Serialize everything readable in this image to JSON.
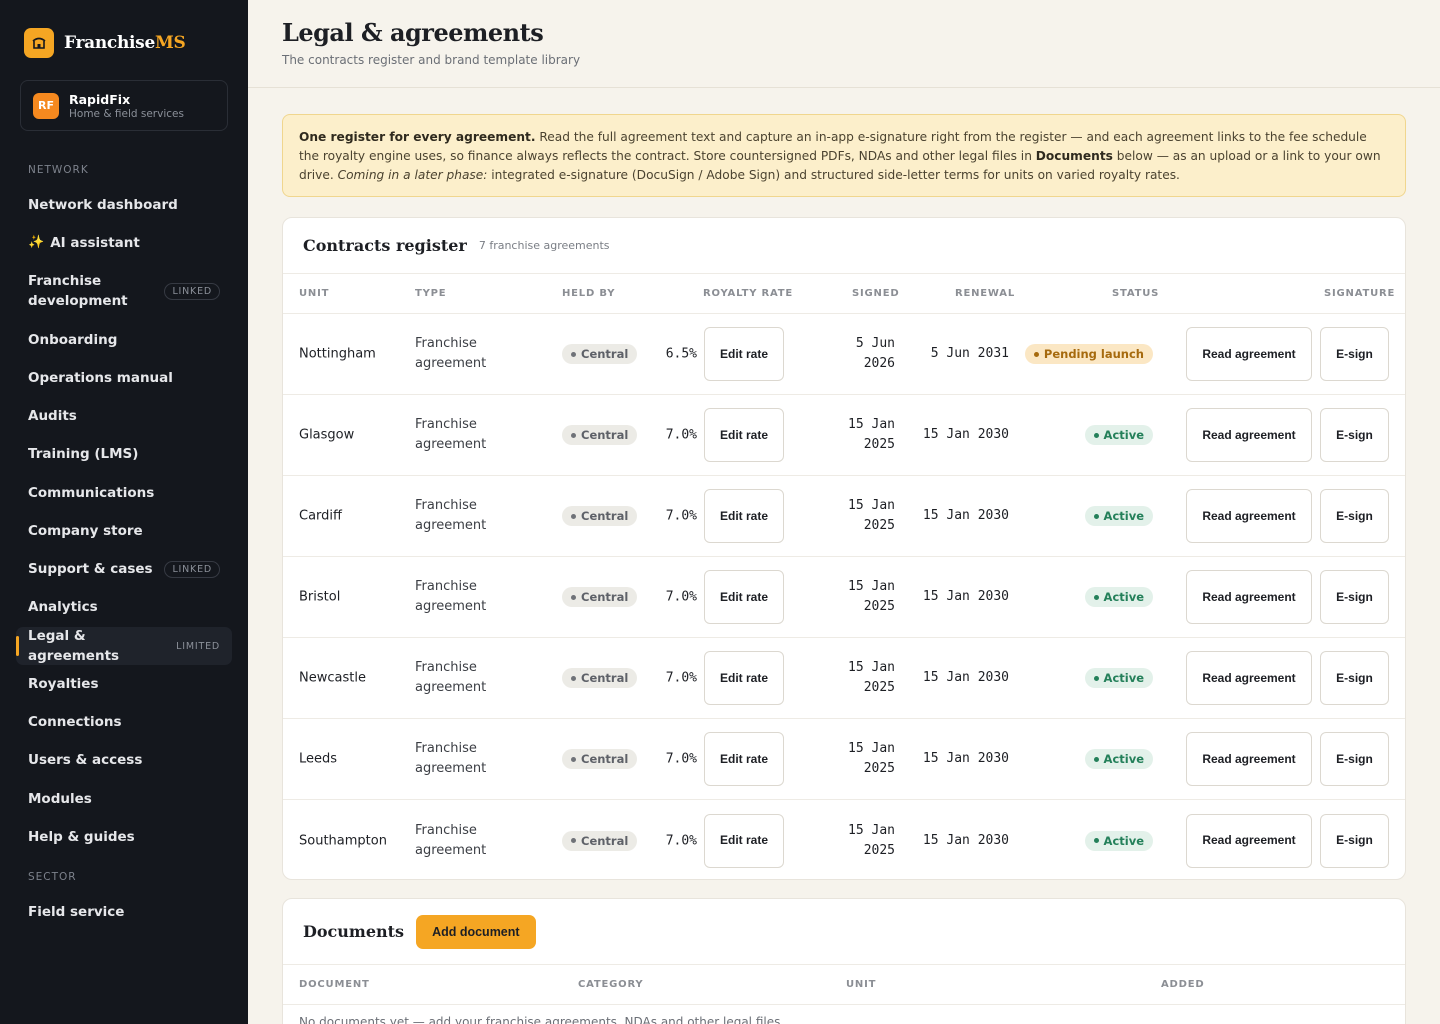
{
  "brand": {
    "name_main": "Franchise",
    "name_accent": "MS"
  },
  "tenant": {
    "initials": "RF",
    "name": "RapidFix",
    "subtitle": "Home & field services"
  },
  "nav": {
    "section_network": "NETWORK",
    "section_sector": "SECTOR",
    "items": [
      {
        "label": "Network dashboard",
        "badge": ""
      },
      {
        "label": "AI assistant",
        "badge": ""
      },
      {
        "label": "Franchise development",
        "badge": "LINKED"
      },
      {
        "label": "Onboarding",
        "badge": ""
      },
      {
        "label": "Operations manual",
        "badge": ""
      },
      {
        "label": "Audits",
        "badge": ""
      },
      {
        "label": "Training (LMS)",
        "badge": ""
      },
      {
        "label": "Communications",
        "badge": ""
      },
      {
        "label": "Company store",
        "badge": ""
      },
      {
        "label": "Support & cases",
        "badge": "LINKED"
      },
      {
        "label": "Analytics",
        "badge": ""
      },
      {
        "label": "Legal & agreements",
        "badge": "LIMITED"
      },
      {
        "label": "Royalties",
        "badge": ""
      },
      {
        "label": "Connections",
        "badge": ""
      },
      {
        "label": "Users & access",
        "badge": ""
      },
      {
        "label": "Modules",
        "badge": ""
      },
      {
        "label": "Help & guides",
        "badge": ""
      }
    ],
    "sector_items": [
      {
        "label": "Field service"
      }
    ]
  },
  "header": {
    "title": "Legal & agreements",
    "subtitle": "The contracts register and brand template library"
  },
  "notice": {
    "bold": "One register for every agreement.",
    "text1": " Read the full agreement text and capture an in-app e-signature right from the register — and each agreement links to the fee schedule the royalty engine uses, so finance always reflects the contract. Store countersigned PDFs, NDAs and other legal files in ",
    "docs": "Documents",
    "text2": " below — as an upload or a link to your own drive. ",
    "italic": "Coming in a later phase:",
    "text3": " integrated e-signature (DocuSign / Adobe Sign) and structured side-letter terms for units on varied royalty rates."
  },
  "contracts": {
    "title": "Contracts register",
    "meta": "7 franchise agreements",
    "columns": {
      "unit": "UNIT",
      "type": "TYPE",
      "held_by": "HELD BY",
      "royalty": "ROYALTY RATE",
      "signed": "SIGNED",
      "renewal": "RENEWAL",
      "status": "STATUS",
      "signature": "SIGNATURE"
    },
    "edit_label": "Edit rate",
    "read_label": "Read agreement",
    "esign_label": "E-sign",
    "rows": [
      {
        "unit": "Nottingham",
        "type": "Franchise agreement",
        "held_by": "Central",
        "rate": "6.5%",
        "signed": "5 Jun 2026",
        "renewal": "5 Jun 2031",
        "status": "Pending launch",
        "status_kind": "pending"
      },
      {
        "unit": "Glasgow",
        "type": "Franchise agreement",
        "held_by": "Central",
        "rate": "7.0%",
        "signed": "15 Jan 2025",
        "renewal": "15 Jan 2030",
        "status": "Active",
        "status_kind": "active"
      },
      {
        "unit": "Cardiff",
        "type": "Franchise agreement",
        "held_by": "Central",
        "rate": "7.0%",
        "signed": "15 Jan 2025",
        "renewal": "15 Jan 2030",
        "status": "Active",
        "status_kind": "active"
      },
      {
        "unit": "Bristol",
        "type": "Franchise agreement",
        "held_by": "Central",
        "rate": "7.0%",
        "signed": "15 Jan 2025",
        "renewal": "15 Jan 2030",
        "status": "Active",
        "status_kind": "active"
      },
      {
        "unit": "Newcastle",
        "type": "Franchise agreement",
        "held_by": "Central",
        "rate": "7.0%",
        "signed": "15 Jan 2025",
        "renewal": "15 Jan 2030",
        "status": "Active",
        "status_kind": "active"
      },
      {
        "unit": "Leeds",
        "type": "Franchise agreement",
        "held_by": "Central",
        "rate": "7.0%",
        "signed": "15 Jan 2025",
        "renewal": "15 Jan 2030",
        "status": "Active",
        "status_kind": "active"
      },
      {
        "unit": "Southampton",
        "type": "Franchise agreement",
        "held_by": "Central",
        "rate": "7.0%",
        "signed": "15 Jan 2025",
        "renewal": "15 Jan 2030",
        "status": "Active",
        "status_kind": "active"
      }
    ]
  },
  "documents": {
    "title": "Documents",
    "add_label": "Add document",
    "columns": {
      "document": "DOCUMENT",
      "category": "CATEGORY",
      "unit": "UNIT",
      "added": "ADDED"
    },
    "empty_text": "No documents yet — add your franchise agreements, NDAs and other legal files."
  },
  "colors": {
    "accent": "#f5a623",
    "sidebar": "#14171d",
    "active": "#24805a",
    "pending": "#a66a0e"
  }
}
